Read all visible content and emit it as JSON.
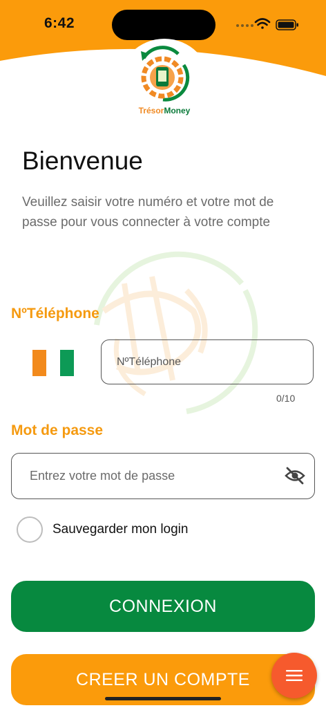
{
  "status_bar": {
    "time": "6:42",
    "icons": [
      "signal-icon",
      "wifi-icon",
      "battery-icon"
    ]
  },
  "brand": {
    "name_part1": "Trésor",
    "name_part2": "Money"
  },
  "welcome": {
    "title": "Bienvenue",
    "subtitle": "Veuillez saisir votre numéro et votre mot de passe pour vous connecter à votre compte"
  },
  "phone": {
    "label": "NºTéléphone",
    "placeholder": "NºTéléphone",
    "counter": "0/10",
    "flag": "cote-divoire-flag"
  },
  "password": {
    "label": "Mot de passe",
    "placeholder": "Entrez votre mot de passe",
    "toggle_icon": "eye-off-icon"
  },
  "remember": {
    "label": "Sauvegarder mon login",
    "checked": false
  },
  "buttons": {
    "login": "CONNEXION",
    "create": "CREER UN COMPTE"
  },
  "fab": {
    "icon": "menu-icon"
  },
  "colors": {
    "orange": "#fb9b0b",
    "green": "#07893f",
    "label_orange": "#f59a10",
    "fab": "#f65a2d"
  }
}
